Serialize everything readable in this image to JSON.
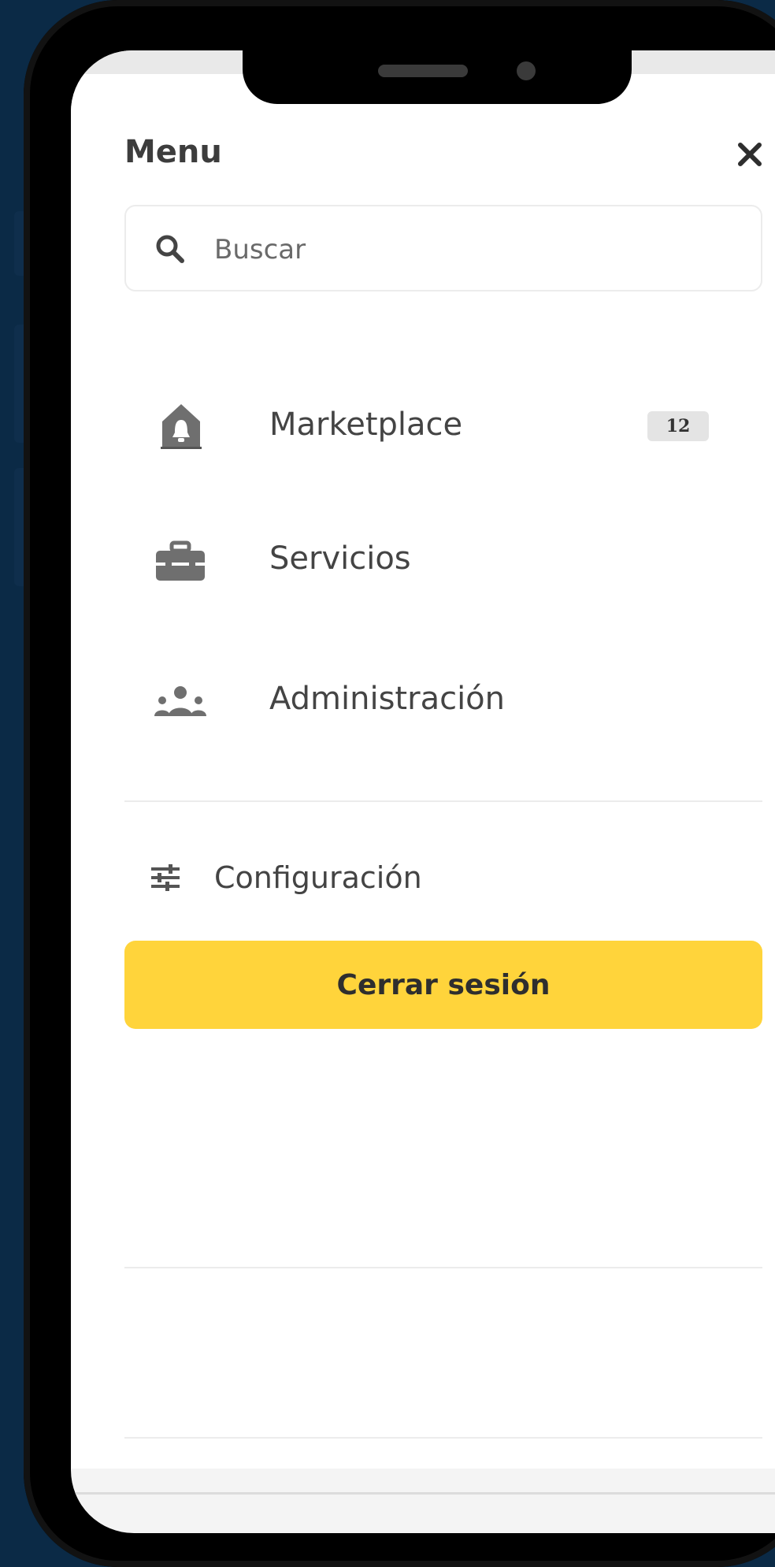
{
  "menu": {
    "title": "Menu"
  },
  "search": {
    "placeholder": "Buscar"
  },
  "nav": {
    "items": [
      {
        "label": "Marketplace",
        "icon": "bell-house-icon",
        "badge": "12"
      },
      {
        "label": "Servicios",
        "icon": "toolbox-icon"
      },
      {
        "label": "Administración",
        "icon": "users-icon"
      }
    ]
  },
  "settings": {
    "label": "Configuración",
    "icon": "sliders-icon"
  },
  "logout": {
    "label": "Cerrar sesión"
  },
  "colors": {
    "background": "#0b2a46",
    "accent": "#ffd43b"
  }
}
